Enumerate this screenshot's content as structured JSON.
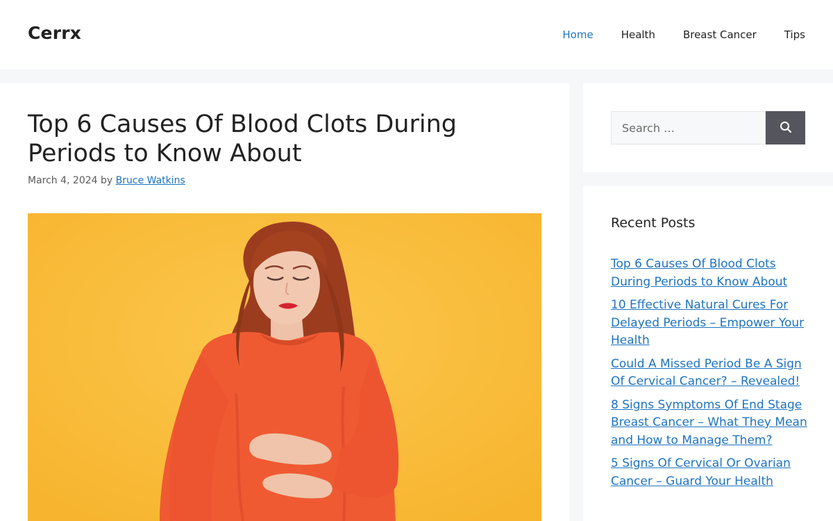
{
  "header": {
    "site_title": "Cerrx",
    "nav": [
      {
        "label": "Home",
        "current": true
      },
      {
        "label": "Health",
        "current": false
      },
      {
        "label": "Breast Cancer",
        "current": false
      },
      {
        "label": "Tips",
        "current": false
      }
    ]
  },
  "article": {
    "title": "Top 6 Causes Of Blood Clots During Periods to Know About",
    "date": "March 4, 2024",
    "by": "by",
    "author": "Bruce Watkins",
    "featured_image": "woman in orange sweater holding stomach on yellow background"
  },
  "sidebar": {
    "search": {
      "placeholder": "Search …",
      "submit_icon": "search-icon"
    },
    "recent_posts": {
      "title": "Recent Posts",
      "items": [
        "Top 6 Causes Of Blood Clots During Periods to Know About",
        "10 Effective Natural Cures For Delayed Periods – Empower Your Health",
        "Could A Missed Period Be A Sign Of Cervical Cancer? – Revealed!",
        "8 Signs Symptoms Of End Stage Breast Cancer – What They Mean and How to Manage Them?",
        "5 Signs Of Cervical Or Ovarian Cancer – Guard Your Health"
      ]
    }
  },
  "colors": {
    "link": "#1e73be",
    "page_background": "#f6f7f8",
    "search_button": "#55555e",
    "image_background": "#fbbf3f",
    "sweater": "#f05a32"
  }
}
